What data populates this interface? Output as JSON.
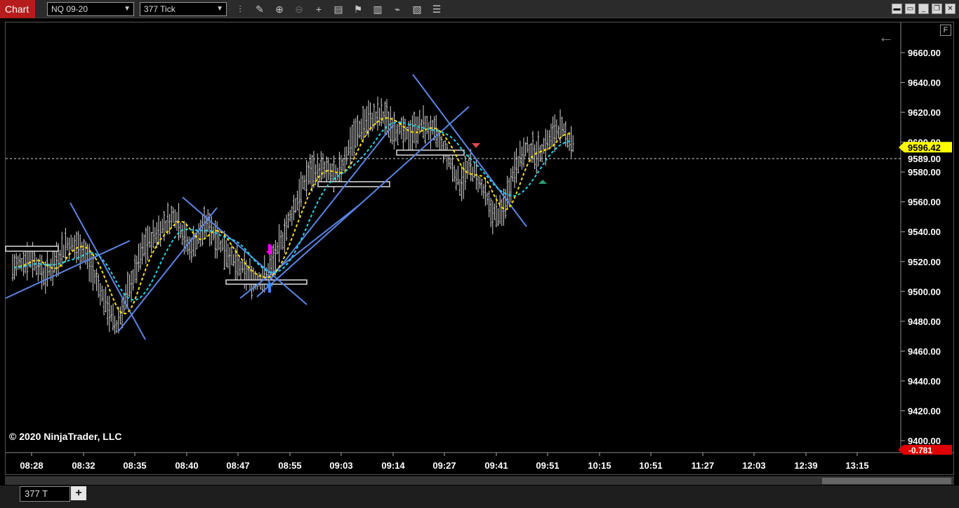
{
  "toolbar": {
    "chart_tab": "Chart",
    "instrument": "NQ 09-20",
    "period": "377 Tick",
    "icons": [
      "bar-style-icon",
      "drawing-tool-icon",
      "zoom-in-icon",
      "zoom-out-icon",
      "crosshair-icon",
      "properties-icon",
      "strategies-icon",
      "indicators-icon",
      "data-series-icon",
      "templates-icon",
      "list-icon"
    ],
    "window_buttons": [
      "minimize-icon",
      "restore-icon",
      "maximize-icon",
      "close-icon"
    ]
  },
  "chart": {
    "copyright": "© 2020 NinjaTrader, LLC",
    "price_labels": [
      "9660.00",
      "9640.00",
      "9620.00",
      "9600.00",
      "9580.00",
      "9560.00",
      "9540.00",
      "9520.00",
      "9500.00",
      "9480.00",
      "9460.00",
      "9440.00",
      "9420.00",
      "9400.00"
    ],
    "current_price": "9589.00",
    "flag_price": "9596.42",
    "flag_red": "-0.781",
    "time_labels": [
      "08:28",
      "08:32",
      "08:35",
      "08:40",
      "08:47",
      "08:55",
      "09:03",
      "09:14",
      "09:27",
      "09:41",
      "09:51",
      "10:15",
      "10:51",
      "11:27",
      "12:03",
      "12:39",
      "13:15"
    ],
    "colors": {
      "bars": "#d9d9d9",
      "ma_yellow": "#ffe000",
      "ma_cyan": "#22d3e8",
      "trendlines": "#5b86e5",
      "flag": "#ffff00",
      "flag_red": "#e00000"
    }
  },
  "bottom": {
    "tab_label": "377 T",
    "add_label": "+"
  }
}
